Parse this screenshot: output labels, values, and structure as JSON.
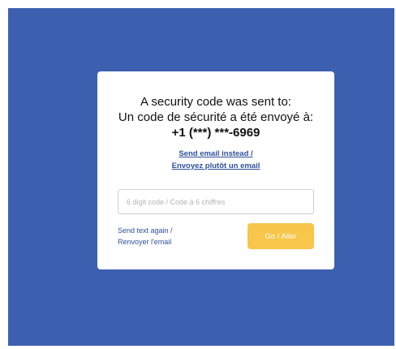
{
  "background_color": "#3d5fb0",
  "accent_color": "#f7c64a",
  "link_color": "#2f4f9e",
  "dialog": {
    "heading_en": "A security code was sent to:",
    "heading_fr": "Un code de sécurité a été envoyé à:",
    "phone": "+1 (***) ***-6969",
    "email_link_line1": "Send email instead /",
    "email_link_line2": "Envoyez plutôt un email",
    "code_placeholder": "6 digit code / Code à 6 chiffres",
    "code_value": "",
    "resend_line1": "Send text again /",
    "resend_line2": "Renvoyer l'email",
    "go_label": "Go / Aller"
  }
}
